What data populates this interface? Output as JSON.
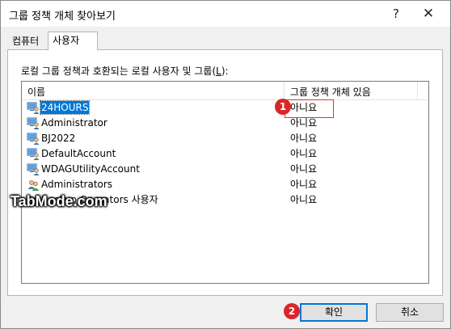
{
  "window": {
    "title": "그룹 정책 개체 찾아보기",
    "help": "?",
    "close": "✕"
  },
  "tabs": [
    {
      "label": "컴퓨터"
    },
    {
      "label": "사용자"
    }
  ],
  "panel": {
    "label_prefix": "로컬 그룹 정책과 호환되는 로컬 사용자 및 그룹(",
    "label_hotkey": "L",
    "label_suffix": "):"
  },
  "list": {
    "columns": [
      "이름",
      "그룹 정책 개체 있음"
    ],
    "rows": [
      {
        "name": "24HOURS",
        "gpo": "아니요",
        "type": "user",
        "selected": true
      },
      {
        "name": "Administrator",
        "gpo": "아니요",
        "type": "user"
      },
      {
        "name": "BJ2022",
        "gpo": "아니요",
        "type": "user"
      },
      {
        "name": "DefaultAccount",
        "gpo": "아니요",
        "type": "user"
      },
      {
        "name": "WDAGUtilityAccount",
        "gpo": "아니요",
        "type": "user"
      },
      {
        "name": "Administrators",
        "gpo": "아니요",
        "type": "group"
      },
      {
        "name": "Backup Operators 사용자",
        "gpo": "아니요",
        "type": "group"
      }
    ]
  },
  "annotations": {
    "badge1": "1",
    "badge2": "2"
  },
  "watermark": "TabMode.com",
  "buttons": {
    "ok": "확인",
    "cancel": "취소"
  },
  "colors": {
    "selection": "#0078d7",
    "annotation": "#d9262b"
  }
}
